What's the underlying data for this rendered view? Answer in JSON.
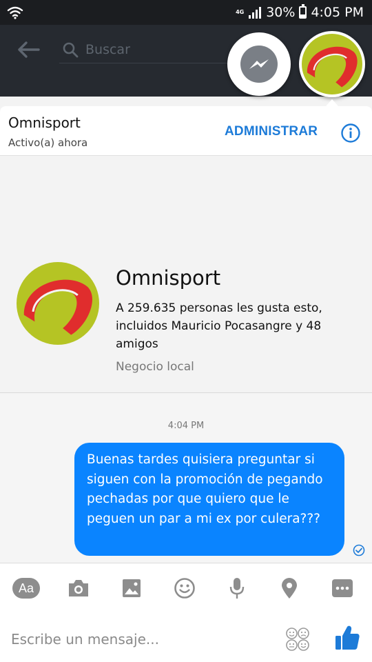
{
  "status_bar": {
    "network": "4G",
    "battery_percent": "30%",
    "battery_level": 0.3,
    "time": "4:05 PM",
    "icons": [
      "wifi-icon",
      "signal-icon",
      "battery-icon"
    ]
  },
  "app_bar": {
    "search_placeholder": "Buscar",
    "icons": [
      "back-arrow-icon",
      "search-icon",
      "messenger-icon"
    ]
  },
  "chat": {
    "title": "Omnisport",
    "status": "Activo(a) ahora",
    "manage_label": "ADMINISTRAR",
    "icons": [
      "info-icon"
    ]
  },
  "profile": {
    "name": "Omnisport",
    "likes_text": "A 259.635 personas les gusta esto, incluidos Mauricio Pocasangre y 48 amigos",
    "category": "Negocio local",
    "logo_colors": {
      "green": "#b5c424",
      "red": "#e02d2d"
    }
  },
  "messages": [
    {
      "time": "4:04 PM",
      "text": "Buenas tardes quisiera preguntar si siguen con la promoción de pegando pechadas por que quiero que le peguen un par a mi ex por culera???",
      "direction": "outgoing",
      "status_icon": "seen-check-icon"
    }
  ],
  "composer": {
    "aa_label": "Aa",
    "placeholder": "Escribe un mensaje...",
    "tools": [
      "camera-icon",
      "gallery-icon",
      "emoji-icon",
      "microphone-icon",
      "location-icon",
      "more-icon"
    ],
    "icons": [
      "sticker-icon",
      "thumbs-up-icon"
    ]
  },
  "colors": {
    "accent": "#1d7bd8",
    "bubble": "#0a84ff",
    "status_bar": "#1b1d20",
    "app_bar": "#262a30"
  }
}
